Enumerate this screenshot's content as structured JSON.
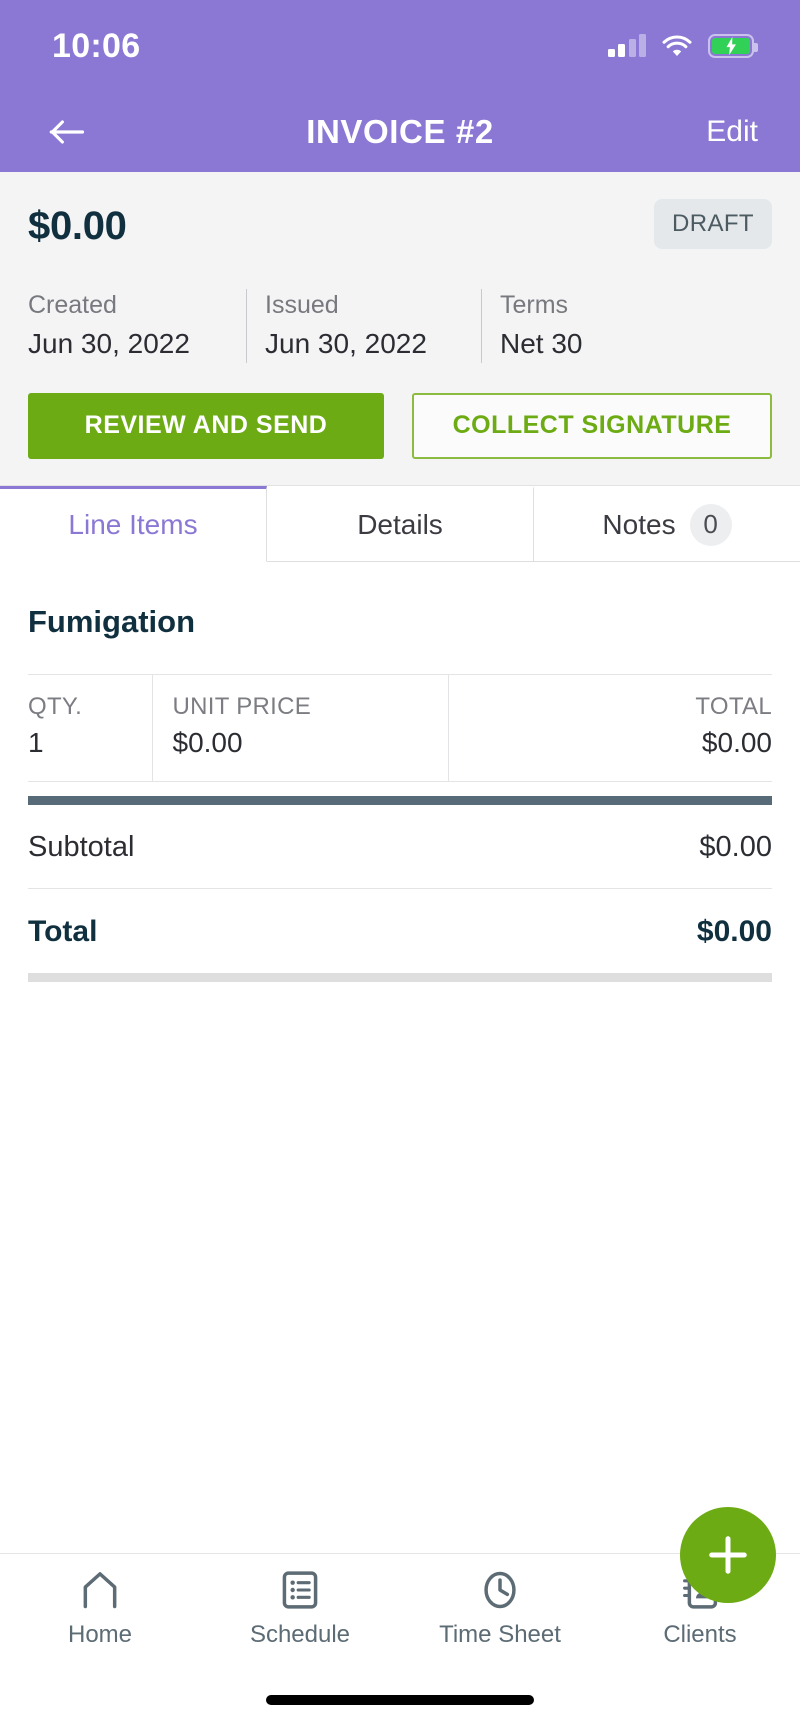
{
  "status_bar": {
    "time": "10:06",
    "signal_icon": "cellular-signal-icon",
    "wifi_icon": "wifi-icon",
    "battery_icon": "battery-charging-icon"
  },
  "header": {
    "back_icon": "arrow-left-icon",
    "title": "INVOICE #2",
    "edit_label": "Edit",
    "background_color": "#8b77d4"
  },
  "summary": {
    "amount": "$0.00",
    "status": "DRAFT",
    "meta": [
      {
        "label": "Created",
        "value": "Jun 30, 2022"
      },
      {
        "label": "Issued",
        "value": "Jun 30, 2022"
      },
      {
        "label": "Terms",
        "value": "Net 30"
      }
    ],
    "primary_action": "REVIEW AND SEND",
    "secondary_action": "COLLECT SIGNATURE",
    "primary_color": "#6cab14"
  },
  "tabs": [
    {
      "label": "Line Items",
      "active": true,
      "badge": null
    },
    {
      "label": "Details",
      "active": false,
      "badge": null
    },
    {
      "label": "Notes",
      "active": false,
      "badge": "0"
    }
  ],
  "line_items": {
    "title": "Fumigation",
    "columns": [
      "QTY.",
      "UNIT PRICE",
      "TOTAL"
    ],
    "rows": [
      {
        "qty": "1",
        "unit_price": "$0.00",
        "total": "$0.00"
      }
    ]
  },
  "totals": [
    {
      "label": "Subtotal",
      "value": "$0.00",
      "emphasis": false
    },
    {
      "label": "Total",
      "value": "$0.00",
      "emphasis": true
    }
  ],
  "bottom_nav": [
    {
      "label": "Home",
      "icon": "home-icon"
    },
    {
      "label": "Schedule",
      "icon": "list-icon"
    },
    {
      "label": "Time Sheet",
      "icon": "clock-icon"
    },
    {
      "label": "Clients",
      "icon": "contact-book-icon"
    }
  ],
  "fab": {
    "icon": "plus-icon",
    "color": "#6cab14"
  }
}
